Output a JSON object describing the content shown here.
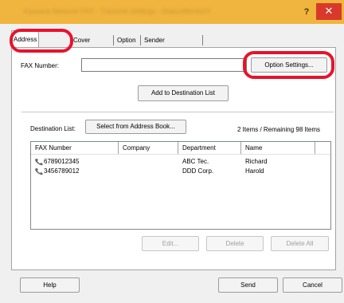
{
  "window": {
    "title": "Kyocera Network FAX - Transmit Settings - StatusMonitorX",
    "help_label": "?",
    "close_label": "✕"
  },
  "tabs": [
    {
      "label": "Address Setting"
    },
    {
      "label": "Cover Page"
    },
    {
      "label": "Option"
    },
    {
      "label": "Sender Information"
    }
  ],
  "fax_number": {
    "label": "FAX Number:",
    "value": ""
  },
  "buttons": {
    "option_settings": "Option Settings...",
    "add_destination": "Add to Destination List",
    "select_address_book": "Select from Address Book...",
    "edit": "Edit...",
    "delete": "Delete",
    "delete_all": "Delete All",
    "help": "Help",
    "send": "Send",
    "cancel": "Cancel"
  },
  "destination": {
    "label": "Destination List:",
    "count_text": "2 Items / Remaining 98  Items"
  },
  "list": {
    "columns": [
      "FAX Number",
      "Company",
      "Department",
      "Name"
    ],
    "rows": [
      {
        "fax": "6789012345",
        "company": "",
        "department": "ABC Tec.",
        "name": "Richard"
      },
      {
        "fax": "3456789012",
        "company": "",
        "department": "DDD Corp.",
        "name": "Harold"
      }
    ]
  },
  "colors": {
    "highlight": "#e8132b",
    "titlebar": "#f0b53f",
    "close": "#d8392b"
  }
}
